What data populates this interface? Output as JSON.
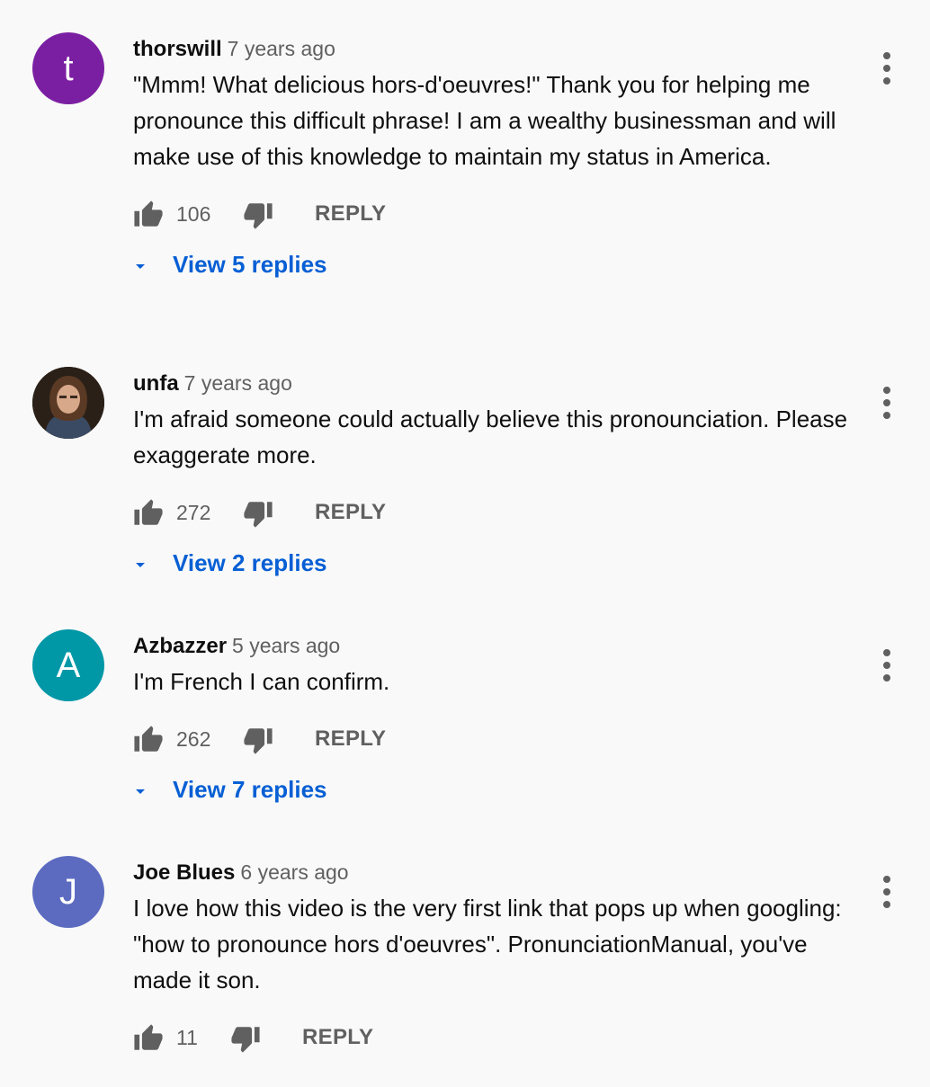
{
  "comments": [
    {
      "author": "thorswill",
      "time": "7 years ago",
      "avatar_letter": "t",
      "avatar_color": "#7b1fa2",
      "text": "\"Mmm! What delicious hors-d'oeuvres!\" Thank you for helping me pronounce this difficult phrase! I am a wealthy businessman and will make use of this knowledge to maintain my status in America.",
      "likes": "106",
      "reply_label": "REPLY",
      "view_replies": "View 5 replies"
    },
    {
      "author": "unfa",
      "time": "7 years ago",
      "avatar_letter": "",
      "avatar_color": "#2a2018",
      "text": "I'm afraid someone could actually believe this pronounciation. Please exaggerate more.",
      "likes": "272",
      "reply_label": "REPLY",
      "view_replies": "View 2 replies"
    },
    {
      "author": "Azbazzer",
      "time": "5 years ago",
      "avatar_letter": "A",
      "avatar_color": "#0097a7",
      "text": "I'm French I can confirm.",
      "likes": "262",
      "reply_label": "REPLY",
      "view_replies": "View 7 replies"
    },
    {
      "author": "Joe Blues",
      "time": "6 years ago",
      "avatar_letter": "J",
      "avatar_color": "#5c6bc0",
      "text": "I love how this video is the very first link that pops up when googling: \"how to pronounce hors d'oeuvres\". PronunciationManual, you've made it son.",
      "likes": "11",
      "reply_label": "REPLY",
      "view_replies": ""
    }
  ],
  "icons": {
    "like": "thumb-up-icon",
    "dislike": "thumb-down-icon",
    "menu": "more-vert-icon",
    "expand": "caret-down-icon"
  },
  "colors": {
    "background": "#f9f9f9",
    "link": "#065fd4",
    "secondary_text": "#606060"
  }
}
